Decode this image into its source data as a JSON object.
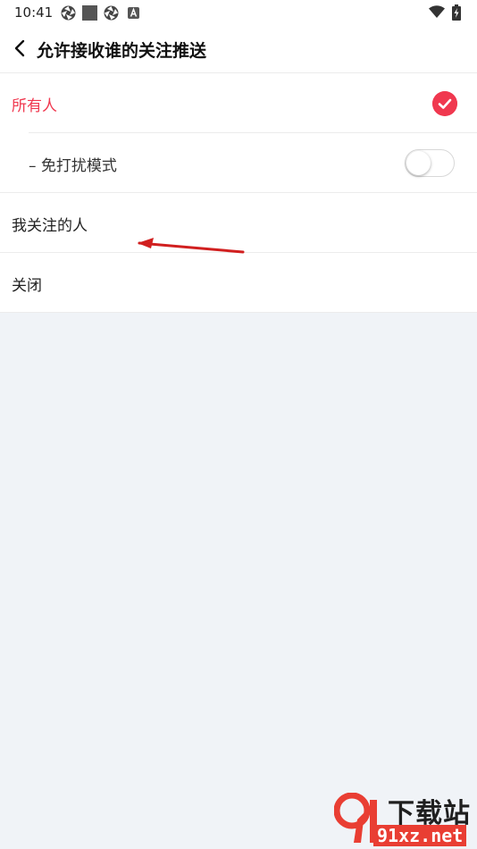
{
  "status_bar": {
    "time": "10:41"
  },
  "header": {
    "title": "允许接收谁的关注推送"
  },
  "options": [
    {
      "label": "所有人",
      "selected": true
    },
    {
      "label": "– 免打扰模式",
      "toggle_on": false
    },
    {
      "label": "我关注的人"
    },
    {
      "label": "关闭"
    }
  ],
  "colors": {
    "accent": "#f0384f",
    "background": "#f0f3f7",
    "annotation": "#d11f1f"
  },
  "icons": {
    "back": "chevron-left-icon",
    "check": "check-circle-icon",
    "status": [
      "aperture-icon",
      "square-icon",
      "aperture-icon",
      "a-box-icon",
      "wifi-icon",
      "battery-charging-icon"
    ]
  },
  "watermark": {
    "text": "下载站",
    "url": "91xz.net"
  }
}
